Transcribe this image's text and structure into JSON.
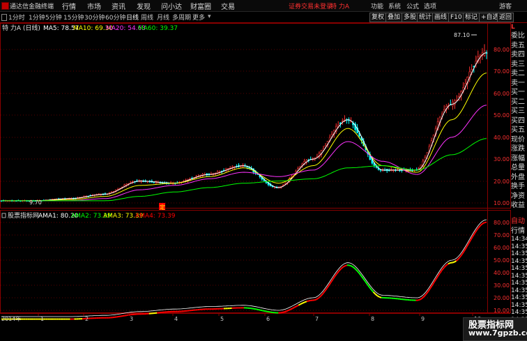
{
  "titlebar": {
    "app_name": "通达信金融终端",
    "menus": [
      "行情",
      "市场",
      "资讯",
      "发现",
      "问小达",
      "财富圈",
      "交易"
    ],
    "login_status": "证券交易未登录",
    "stock_name": "特 力A",
    "right_menus": [
      "功能",
      "系统",
      "公式",
      "选项"
    ],
    "guest": "游客"
  },
  "periodbar": {
    "periods": [
      "1分时",
      "1分钟",
      "5分钟",
      "15分钟",
      "30分钟",
      "60分钟",
      "日线",
      "周线",
      "月线",
      "多周期",
      "更多"
    ],
    "active_period": "日线",
    "tools": [
      "复权",
      "叠加",
      "多股",
      "统计",
      "画线",
      "F10",
      "标记",
      "+自选",
      "返回"
    ]
  },
  "main_chart": {
    "legend_title": "特 力A (日线)",
    "ma": [
      {
        "label": "MA5: 78.57",
        "color": "#ffffff"
      },
      {
        "label": "MA10: 69.30",
        "color": "#ffff00"
      },
      {
        "label": "MA20: 54.63",
        "color": "#ff33ff"
      },
      {
        "label": "MA60: 39.37",
        "color": "#00ff00"
      }
    ],
    "high_label": "87.10",
    "low_label": "9.70",
    "axis_ticks": [
      "80.00",
      "70.00",
      "60.00",
      "50.00",
      "40.00",
      "30.00",
      "20.00",
      "10.00"
    ],
    "marker": "定"
  },
  "indicator_chart": {
    "name": "股票指标网",
    "lines": [
      {
        "label": "AMA1: 80.20",
        "color": "#ffffff"
      },
      {
        "label": "AMA2: 73.39",
        "color": "#00ff00"
      },
      {
        "label": "AMA3: 73.39",
        "color": "#ffff00"
      },
      {
        "label": "AMA4: 73.39",
        "color": "#ff0000"
      }
    ],
    "axis_ticks": [
      "80.00",
      "70.00",
      "60.00",
      "50.00",
      "40.00",
      "30.00",
      "20.00",
      "10.00"
    ]
  },
  "date_axis": [
    "2014年",
    "1",
    "2",
    "3",
    "4",
    "5",
    "6",
    "7",
    "8",
    "9",
    "10"
  ],
  "right_panel": {
    "head": "L",
    "rows": [
      "委比",
      "卖五",
      "卖四",
      "卖三",
      "卖二",
      "卖一",
      "买一",
      "买二",
      "买三",
      "买四",
      "买五",
      "现价",
      "涨跌",
      "涨幅",
      "总量",
      "外盘",
      "换手",
      "净资",
      "收益"
    ],
    "auto": "自动",
    "quote": "行情",
    "times": [
      "14:34",
      "14:35",
      "14:35",
      "14:35",
      "14:35",
      "14:35",
      "14:35",
      "14:35",
      "14:35",
      "14:35",
      "14:35",
      "14:35"
    ]
  },
  "watermark": {
    "line1": "股票指标网",
    "line2": "www.7gpzb.com"
  },
  "chart_data": {
    "type": "line",
    "title": "特 力A (日线)",
    "x": [
      "2014年",
      "1",
      "2",
      "3",
      "4",
      "5",
      "6",
      "7",
      "8",
      "9",
      "10"
    ],
    "series": [
      {
        "name": "MA5",
        "values": [
          11,
          11,
          12,
          14,
          20,
          19,
          23,
          27,
          17,
          30,
          48,
          25,
          25,
          55,
          78.57
        ]
      },
      {
        "name": "MA10",
        "values": [
          11,
          11,
          11.5,
          13,
          18,
          19,
          22,
          26,
          19,
          27,
          44,
          27,
          24,
          48,
          69.3
        ]
      },
      {
        "name": "MA20",
        "values": [
          11,
          11,
          11,
          12,
          16,
          18,
          21,
          24,
          22,
          25,
          38,
          29,
          23,
          40,
          54.63
        ]
      },
      {
        "name": "MA60",
        "values": [
          11,
          11,
          11,
          11,
          13,
          15,
          17,
          19,
          20,
          21,
          26,
          27,
          25,
          32,
          39.37
        ]
      },
      {
        "name": "AMA1",
        "values": [
          3,
          3,
          3,
          4,
          7,
          9,
          11,
          12,
          8,
          18,
          46,
          20,
          18,
          48,
          80.2
        ]
      }
    ],
    "ylim": [
      8,
      90
    ]
  }
}
